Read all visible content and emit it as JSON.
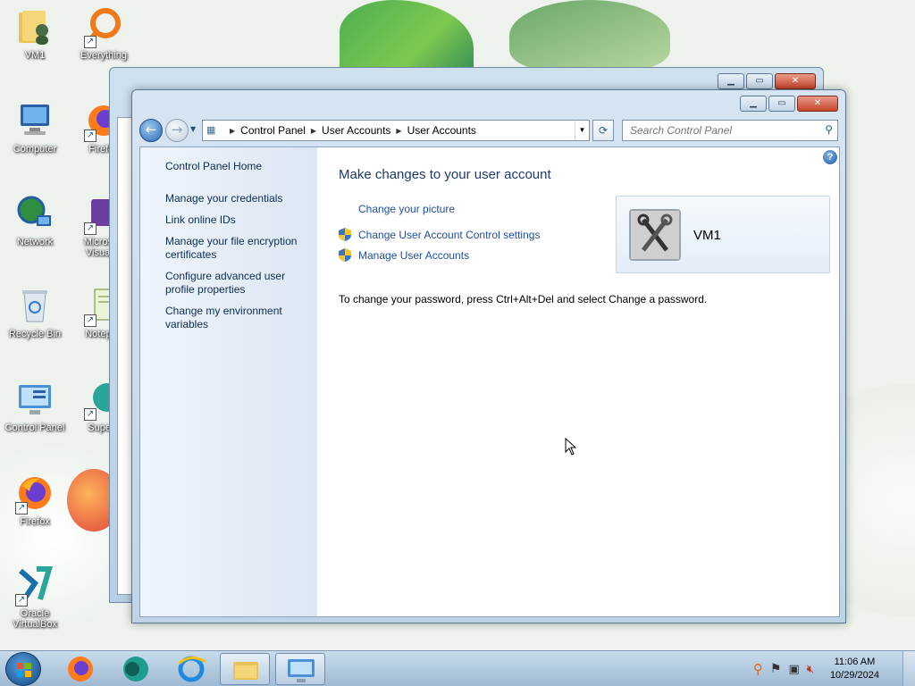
{
  "desktop": {
    "icons": [
      {
        "label": "VM1"
      },
      {
        "label": "Everything"
      },
      {
        "label": "Computer"
      },
      {
        "label": "Firefox"
      },
      {
        "label": "Network"
      },
      {
        "label": "Microsoft Visual S"
      },
      {
        "label": "Recycle Bin"
      },
      {
        "label": "Notepad"
      },
      {
        "label": "Control Panel"
      },
      {
        "label": "Supern"
      },
      {
        "label": "Firefox"
      },
      {
        "label": "Oracle VirtualBox"
      }
    ]
  },
  "window": {
    "address": {
      "segments": [
        "Control Panel",
        "User Accounts",
        "User Accounts"
      ]
    },
    "search": {
      "placeholder": "Search Control Panel"
    },
    "sidebar": {
      "home": "Control Panel Home",
      "links": [
        "Manage your credentials",
        "Link online IDs",
        "Manage your file encryption certificates",
        "Configure advanced user profile properties",
        "Change my environment variables"
      ]
    },
    "main": {
      "title": "Make changes to your user account",
      "tasks": [
        {
          "label": "Change your picture",
          "shield": false
        },
        {
          "label": "Change User Account Control settings",
          "shield": true
        },
        {
          "label": "Manage User Accounts",
          "shield": true
        }
      ],
      "password_note": "To change your password, press Ctrl+Alt+Del and select Change a password.",
      "user": {
        "name": "VM1"
      }
    }
  },
  "taskbar": {
    "clock": {
      "time": "11:06 AM",
      "date": "10/29/2024"
    }
  }
}
